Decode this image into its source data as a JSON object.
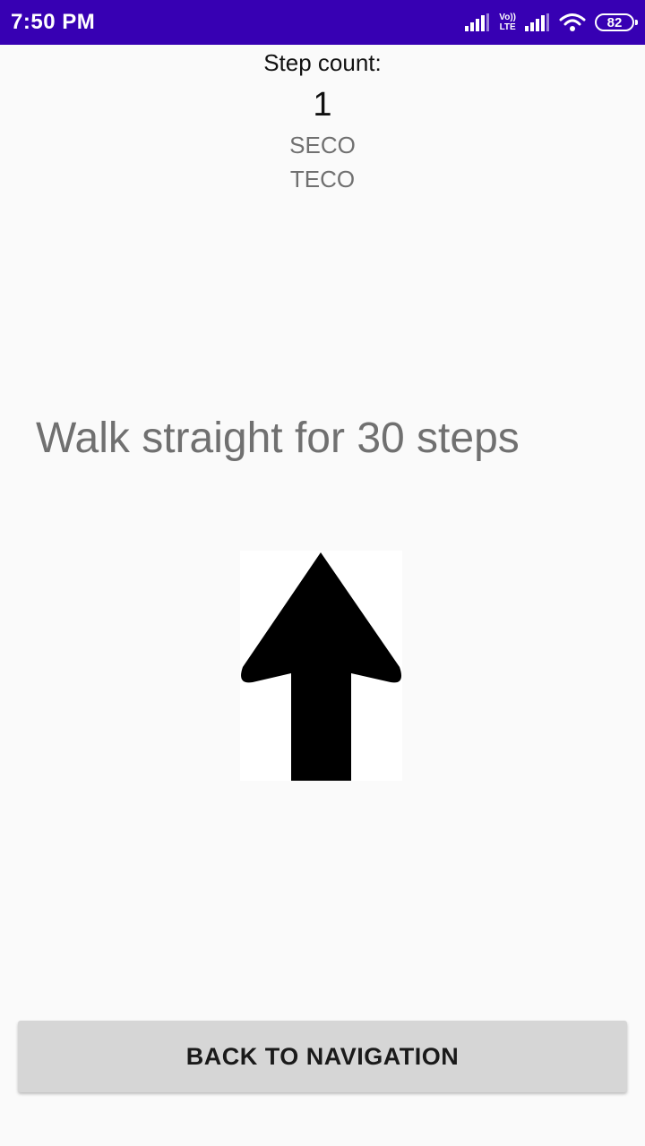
{
  "status_bar": {
    "time": "7:50 PM",
    "network_label_top": "Vo))",
    "network_label_bottom": "LTE",
    "battery_level": "82",
    "background_color": "#3700b3"
  },
  "step_counter": {
    "label": "Step count:",
    "value": "1",
    "line_one": "SECO",
    "line_two": "TECO"
  },
  "instruction": {
    "text": "Walk straight for 30 steps",
    "direction_icon": "arrow-up-icon"
  },
  "actions": {
    "back_label": "BACK TO NAVIGATION"
  }
}
